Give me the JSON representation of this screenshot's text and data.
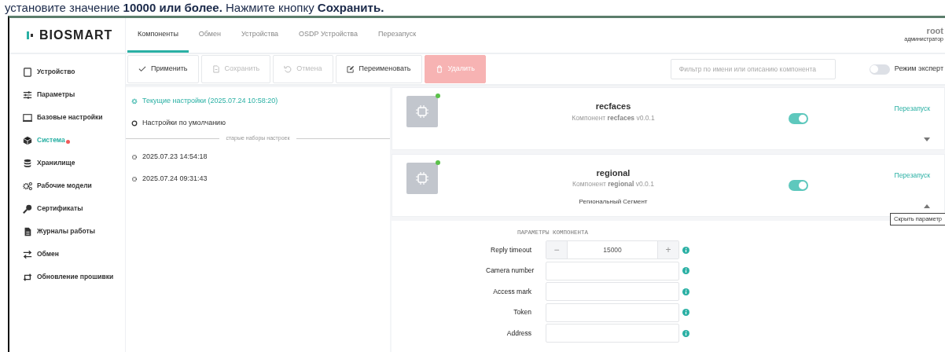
{
  "doc_text": "установите значение **10000 или более.** Нажмите кнопку **Сохранить.**",
  "logo": "BIOSMART",
  "tabs": [
    {
      "label": "Компоненты",
      "selected": true
    },
    {
      "label": "Обмен",
      "selected": false
    },
    {
      "label": "Устройства",
      "selected": false
    },
    {
      "label": "OSDP Устройства",
      "selected": false
    },
    {
      "label": "Перезапуск",
      "selected": false
    }
  ],
  "user": {
    "name": "root",
    "role": "администратор"
  },
  "sidebar": {
    "items": [
      {
        "label": "Устройство",
        "selected": false,
        "alert": false
      },
      {
        "label": "Параметры",
        "selected": false,
        "alert": false
      },
      {
        "label": "Базовые настройки",
        "selected": false,
        "alert": false
      },
      {
        "label": "Система",
        "selected": true,
        "alert": true
      },
      {
        "label": "Хранилище",
        "selected": false,
        "alert": false
      },
      {
        "label": "Рабочие модели",
        "selected": false,
        "alert": false
      },
      {
        "label": "Сертификаты",
        "selected": false,
        "alert": false
      },
      {
        "label": "Журналы работы",
        "selected": false,
        "alert": false
      },
      {
        "label": "Обмен",
        "selected": false,
        "alert": false
      },
      {
        "label": "Обновление прошивки",
        "selected": false,
        "alert": false
      }
    ]
  },
  "toolbar": {
    "buttons": [
      {
        "label": "Применить",
        "kind": "apply",
        "disabled": false
      },
      {
        "label": "Сохранить",
        "kind": "save",
        "disabled": true
      },
      {
        "label": "Отмена",
        "kind": "undo",
        "disabled": true
      },
      {
        "label": "Переименовать",
        "kind": "rename",
        "disabled": false
      },
      {
        "label": "Удалить",
        "kind": "delete",
        "disabled": true
      }
    ],
    "filter": {
      "placeholder": "Фильтр по имени или описанию компонента"
    },
    "expert_mode": {
      "label": "Режим эксперт",
      "on": false
    }
  },
  "settings": {
    "current": {
      "label": "Текущие настройки (2025.07.24 10:58:20)"
    },
    "default": {
      "label": "Настройки по умолчанию"
    },
    "divider": "старые наборы настроек",
    "old": [
      {
        "label": "2025.07.23 14:54:18"
      },
      {
        "label": "2025.07.24 09:31:43"
      }
    ]
  },
  "components": [
    {
      "name": "recfaces",
      "version": "Компонент **recfaces** v0.0.1",
      "online": true,
      "enabled": true,
      "restart": "Перезапуск",
      "expanded": false
    },
    {
      "name": "regional",
      "version": "Компонент **regional** v0.0.1",
      "description": "Региональный Сегмент",
      "online": true,
      "enabled": true,
      "restart": "Перезапуск",
      "expanded": true,
      "tooltip": "Скрыть параметр",
      "params_title": "ПАРАМЕТРЫ КОМПОНЕНТА",
      "params": [
        {
          "label": "Reply timeout",
          "kind": "number",
          "value": "15000",
          "minus": "−",
          "plus": "+"
        },
        {
          "label": "Camera number",
          "kind": "text"
        },
        {
          "label": "Access mark",
          "kind": "text"
        },
        {
          "label": "Token",
          "kind": "text"
        },
        {
          "label": "Address",
          "kind": "text"
        }
      ]
    }
  ]
}
